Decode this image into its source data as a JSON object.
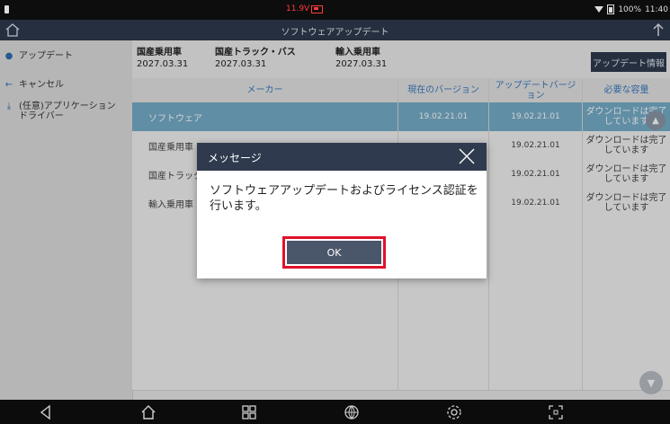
{
  "status_bar": {
    "voltage": "11.9V",
    "battery": "100%",
    "time": "11:40"
  },
  "header": {
    "title": "ソフトウェアアップデート"
  },
  "sidebar": {
    "items": [
      {
        "label": "アップデート",
        "icon": "globe-icon"
      },
      {
        "label": "キャンセル",
        "icon": "arrow-left-icon"
      },
      {
        "label": "(任意)アプリケーション\nドライバー",
        "icon": "download-icon"
      }
    ]
  },
  "vehicles": [
    {
      "name": "国産乗用車",
      "date": "2027.03.31"
    },
    {
      "name": "国産トラック・バス",
      "date": "2027.03.31"
    },
    {
      "name": "輸入乗用車",
      "date": "2027.03.31"
    }
  ],
  "update_info_button": "アップデート情報",
  "table": {
    "headers": {
      "maker": "メーカー",
      "current_version": "現在のバージョン",
      "update_version": "アップデートバージョン",
      "required_capacity": "必要な容量"
    },
    "rows": [
      {
        "maker": "ソフトウェア",
        "current": "19.02.21.01",
        "update": "19.02.21.01",
        "capacity": "ダウンロードは完了しています"
      },
      {
        "maker": "国産乗用車",
        "current": "",
        "update": "19.02.21.01",
        "capacity": "ダウンロードは完了しています"
      },
      {
        "maker": "国産トラック・バス",
        "current": "",
        "update": "19.02.21.01",
        "capacity": "ダウンロードは完了しています"
      },
      {
        "maker": "輸入乗用車",
        "current": "",
        "update": "19.02.21.01",
        "capacity": "ダウンロードは完了しています"
      }
    ]
  },
  "dialog": {
    "title": "メッセージ",
    "message": "ソフトウェアアップデートおよびライセンス認証を行います。",
    "ok_label": "OK"
  },
  "colors": {
    "header_bg": "#2f3a4e",
    "selected_row": "#76aeca",
    "accent_text": "#3a7ac0",
    "highlight_border": "#e0122a"
  }
}
